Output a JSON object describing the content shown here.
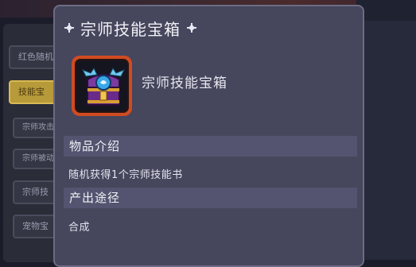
{
  "sidebar": {
    "items": [
      {
        "label": "红色随机",
        "state": "normal"
      },
      {
        "label": "技能宝",
        "state": "active"
      },
      {
        "label": "宗师攻击",
        "state": "normal"
      },
      {
        "label": "宗师被动",
        "state": "normal"
      },
      {
        "label": "宗师技",
        "state": "normal"
      },
      {
        "label": "宠物宝",
        "state": "normal"
      }
    ]
  },
  "tooltip": {
    "title": "宗师技能宝箱",
    "item_name": "宗师技能宝箱",
    "item_icon": "master-skill-chest-icon",
    "sections": [
      {
        "heading": "物品介绍",
        "body": "随机获得1个宗师技能书"
      },
      {
        "heading": "产出途径",
        "body": "合成"
      }
    ]
  },
  "colors": {
    "popup_bg": "#46465d",
    "section_bg": "#545470",
    "icon_frame": "#cf4b22",
    "active_button": "#b79a3a"
  }
}
